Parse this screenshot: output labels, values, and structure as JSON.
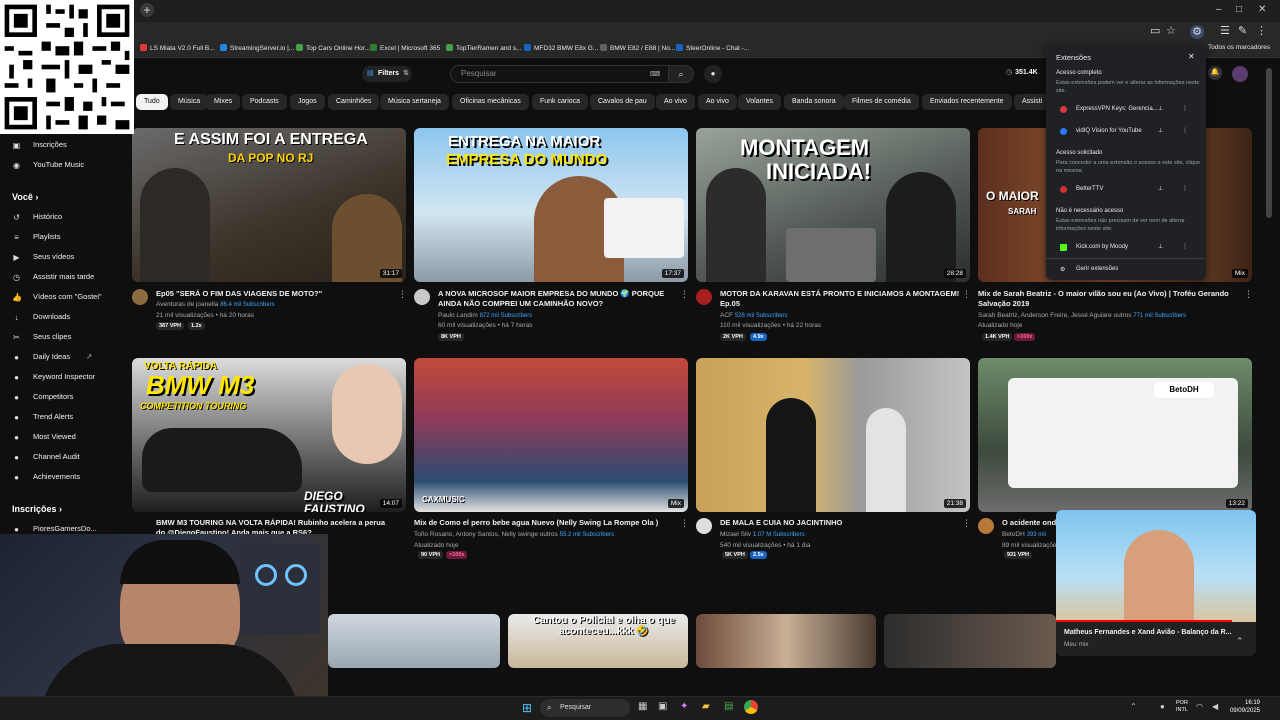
{
  "bookmarks": [
    "LS Miata V2.0 Full B...",
    "StreamingServer.io |...",
    "Top Cars Online Hor...",
    "Excel | Microsoft 365",
    "TopTierRamen and s...",
    "MFD32 BMW E8x G...",
    "BMW E82 / E88 | No...",
    "SteerOnline - Chat -...",
    "Todos os marcadores"
  ],
  "sidebar": {
    "top": [
      {
        "label": "Inscrições",
        "icon": "subscriptions-icon"
      },
      {
        "label": "YouTube Music",
        "icon": "music-icon"
      }
    ],
    "you_heading": "Você",
    "you": [
      {
        "label": "Histórico",
        "icon": "history-icon"
      },
      {
        "label": "Playlists",
        "icon": "playlist-icon"
      },
      {
        "label": "Seus vídeos",
        "icon": "video-icon"
      },
      {
        "label": "Assistir mais tarde",
        "icon": "clock-icon"
      },
      {
        "label": "Vídeos com \"Gostei\"",
        "icon": "like-icon"
      },
      {
        "label": "Downloads",
        "icon": "download-icon"
      },
      {
        "label": "Seus clipes",
        "icon": "clip-icon"
      }
    ],
    "vidiq": [
      {
        "label": "Daily Ideas"
      },
      {
        "label": "Keyword Inspector"
      },
      {
        "label": "Competitors"
      },
      {
        "label": "Trend Alerts"
      },
      {
        "label": "Most Viewed"
      },
      {
        "label": "Channel Audit"
      },
      {
        "label": "Achievements"
      }
    ],
    "subs_heading": "Inscrições",
    "subs": [
      {
        "label": "PioresGamersDo..."
      }
    ]
  },
  "masthead": {
    "filters": "Filters",
    "search_placeholder": "Pesquisar",
    "vph": "351.4K"
  },
  "chips": [
    "Tudo",
    "Música",
    "Mixes",
    "Podcasts",
    "Jogos",
    "Caminhões",
    "Música sertaneja",
    "Oficinas mecânicas",
    "Funk carioca",
    "Cavalos de pau",
    "Ao vivo",
    "Ao vivo",
    "Volantes",
    "Banda sonora",
    "Filmes de comédia",
    "Enviados recentemente",
    "Assisti"
  ],
  "videos": [
    {
      "cap": "E ASSIM FOI A ENTREGA",
      "cap2": "DA POP NO RJ",
      "dur": "31:17",
      "title": "Ep05 \"SERÁ O FIM DAS VIAGENS DE MOTO?\"",
      "title2": "",
      "channel": "Aventuras de joanella",
      "subs": "86.4 mil Subscribers",
      "meta": "21 mil visualizações • há 20 horas",
      "b1": "387 VPH",
      "b2": "1.2x"
    },
    {
      "cap": "ENTREGA NA MAIOR",
      "cap2": "EMPRESA DO MUNDO",
      "dur": "17:37",
      "title": "A NOVA MICROSOF MAIOR EMPRESA DO MUNDO 🌍 PORQUE",
      "title2": "AINDA NÃO COMPREI UM CAMINHÃO NOVO?",
      "channel": "Paulo Landim",
      "subs": "872 mil Subscribers",
      "meta": "60 mil visualizações • há 7 horas",
      "b1": "8K VPH",
      "b2": ""
    },
    {
      "cap": "MONTAGEM",
      "cap2": "INICIADA!",
      "dur": "28:28",
      "title": "MOTOR DA KARAVAN ESTÁ PRONTO E INICIAMOS A MONTAGEM!",
      "title2": "Ep.05",
      "channel": "ACF",
      "subs": "526 mil Subscribers",
      "meta": "110 mil visualizações • há 22 horas",
      "b1": "2K VPH",
      "b2": "4.9x"
    },
    {
      "cap": "O MAIOR",
      "cap2": "SARAH",
      "dur": "Mix",
      "title": "Mix de Sarah Beatriz - O maior vilão sou eu (Ao Vivo) | Troféu Gerando",
      "title2": "Salvação 2019",
      "channel": "Sarah Beatriz, Anderson Freire, Jessé Aguiare outros",
      "subs": "771 mil Subscribers",
      "meta": "Atualizado hoje",
      "b1": "1.4K VPH",
      "b2": ">100x"
    },
    {
      "cap": "VOLTA RÁPIDA",
      "cap2": "BMW M3",
      "dur": "14:07",
      "title": "BMW M3 TOURING NA VOLTA RÁPIDA! Rubinho acelera a perua",
      "title2": "do @DiegoFaustino! Anda mais que a RS6?",
      "channel": "",
      "subs": "",
      "meta": "",
      "b1": "",
      "b2": ""
    },
    {
      "cap": "",
      "cap2": "CAXMUSIC",
      "dur": "Mix",
      "title": "Mix de Como el perro bebe agua Nuevo  (Nelly Swing La Rompe Ola )",
      "title2": "",
      "channel": "Toño Rosario, Antony Santos, Nelly swinge outros",
      "subs": "55.2 mil Subscribers",
      "meta": "Atualizado hoje",
      "b1": "90 VPH",
      "b2": ">100x"
    },
    {
      "cap": "",
      "cap2": "",
      "dur": "21:38",
      "title": "DE MALA E CUIA NO JACINTINHO",
      "title2": "",
      "channel": "Mizael Silv",
      "subs": "1.07 M Subscribers",
      "meta": "540 mil visualizações • há 1 dia",
      "b1": "5K VPH",
      "b2": "2.5x"
    },
    {
      "cap": "",
      "cap2": "BetoDH",
      "dur": "13:22",
      "title": "O acidente ond",
      "title2": "",
      "channel": "BetoDH",
      "subs": "393 mil",
      "meta": "89 mil visualizações",
      "b1": "931 VPH",
      "b2": ""
    }
  ],
  "row3_caption": "Cantou o Policial e olha o que aconteceu...kkk 🤣",
  "subheading_extra": "COMPETITION TOURING",
  "diego": "DIEGO FAUSTINO",
  "extensions": {
    "title": "Extensões",
    "full": "Acesso completo",
    "full_desc": "Estas extensões podem ver e alterar as informações neste site.",
    "items_full": [
      "ExpressVPN Keys: Gerencia...",
      "vidIQ Vision for YouTube"
    ],
    "requested": "Acesso solicitado",
    "requested_desc": "Para conceder a uma extensão o acesso a este site, clique na mesma",
    "items_req": [
      "BetterTTV"
    ],
    "not_needed": "Não é necessário acesso",
    "not_needed_desc": "Estas extensões não precisam de ver nem de alterar informações neste site.",
    "items_no": [
      "Kick.com by Moody"
    ],
    "manage": "Gerir extensões"
  },
  "mini": {
    "title": "Matheus Fernandes e Xand Avião - Balanço da R...",
    "sub": "Meu mix"
  },
  "taskbar": {
    "search": "Pesquisar",
    "lang1": "POR",
    "lang2": "INTL",
    "time": "16:19",
    "date": "09/09/2025"
  }
}
